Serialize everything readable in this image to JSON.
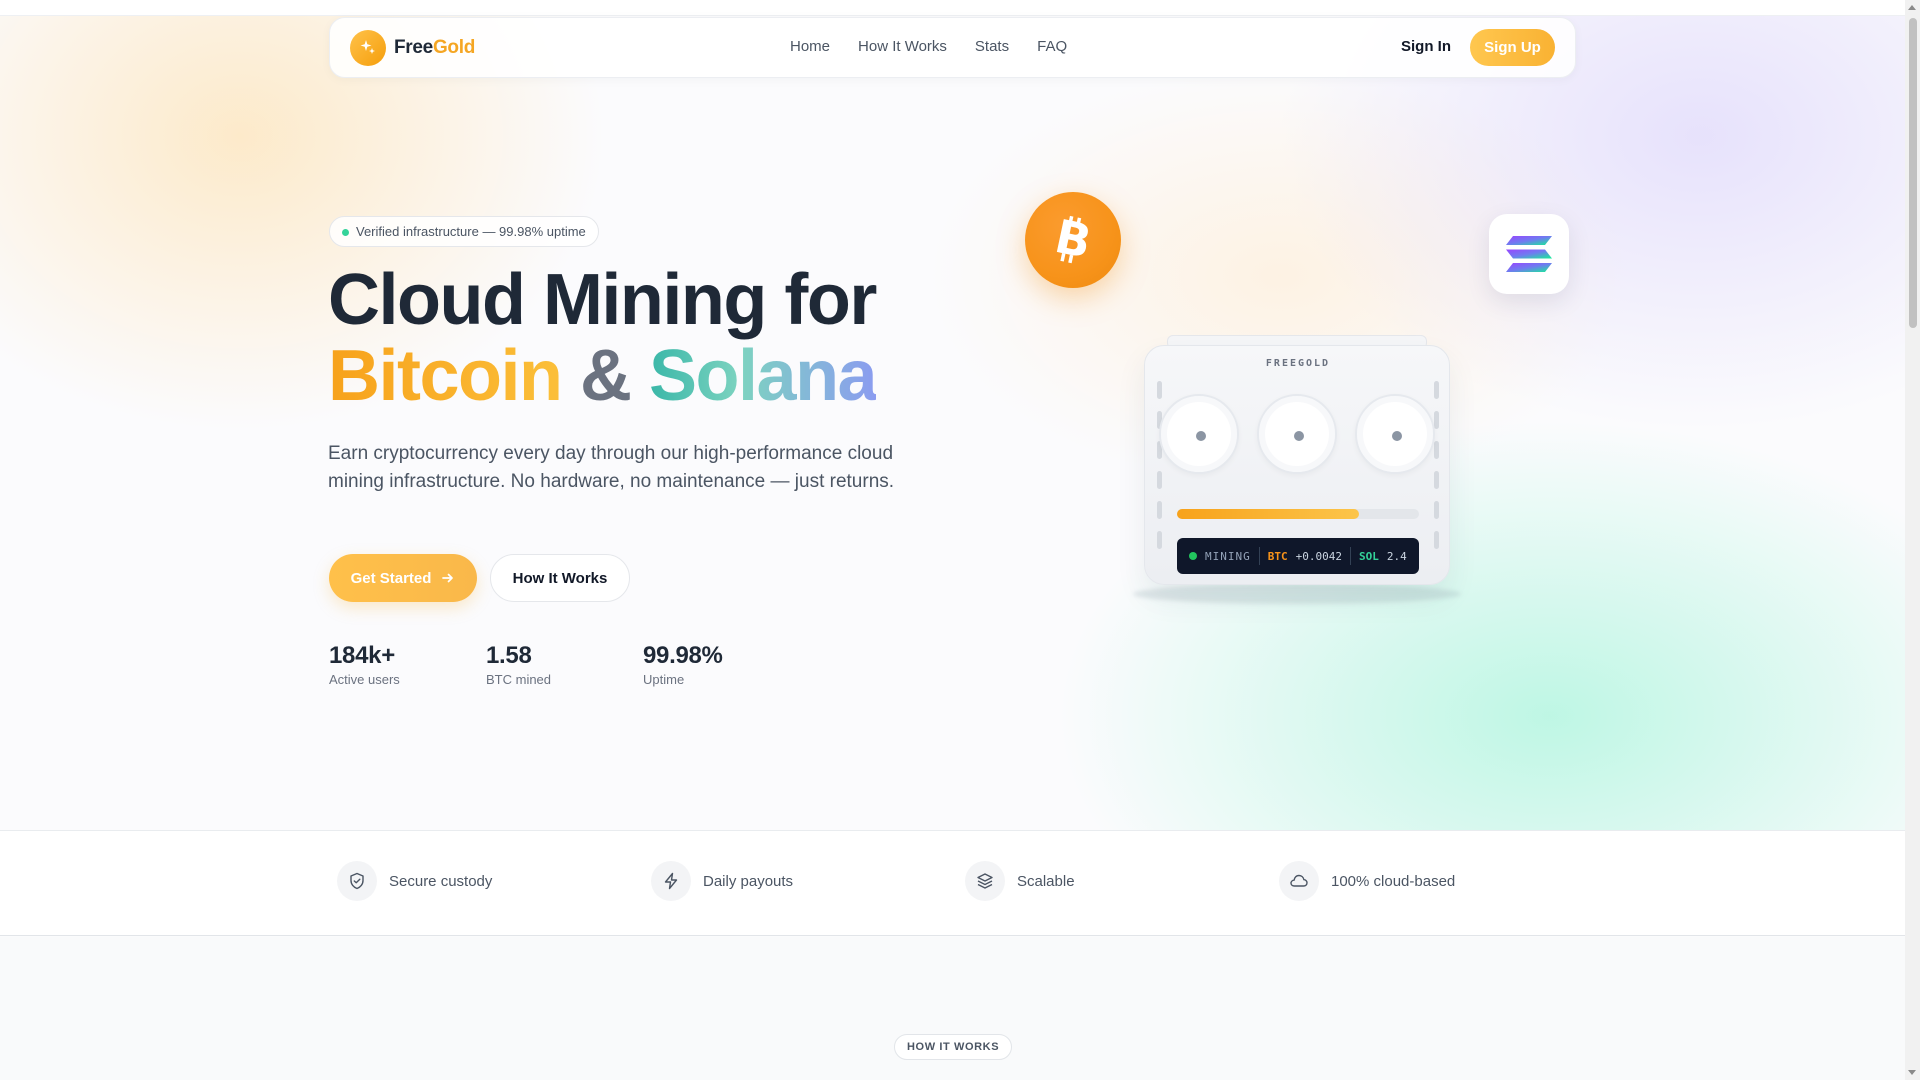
{
  "nav": {
    "brand_part1": "Free",
    "brand_part2": "Gold",
    "links": [
      "Home",
      "How It Works",
      "Stats",
      "FAQ"
    ],
    "signin_label": "Sign In",
    "signup_label": "Sign Up"
  },
  "hero": {
    "badge": "Verified infrastructure — 99.98% uptime",
    "title_line1": "Cloud Mining for",
    "title_btc": "Bitcoin",
    "title_amp": "&",
    "title_sol": "Solana",
    "subtitle": "Earn cryptocurrency every day through our high-performance cloud mining infrastructure. No hardware, no maintenance — just returns.",
    "cta_primary": "Get Started",
    "cta_secondary": "How It Works",
    "stats": [
      {
        "value": "184k+",
        "label": "Active users"
      },
      {
        "value": "1.58",
        "label": "BTC mined"
      },
      {
        "value": "99.98%",
        "label": "Uptime"
      }
    ]
  },
  "miner": {
    "label": "FREEGOLD",
    "progress": 0.75,
    "terminal_status": "MINING",
    "btc_label": "BTC",
    "btc_value": "+0.0042",
    "sol_label": "SOL",
    "sol_value": "2.4"
  },
  "features": [
    {
      "label": "Secure custody",
      "icon": "shield-icon"
    },
    {
      "label": "Daily payouts",
      "icon": "bolt-icon"
    },
    {
      "label": "Scalable",
      "icon": "layers-icon"
    },
    {
      "label": "100% cloud-based",
      "icon": "cloud-icon"
    }
  ],
  "section_tag": "HOW IT WORKS",
  "colors": {
    "accent": "#f9b233",
    "bitcoin": "#f7931a",
    "solana_teal": "#3ab7a8",
    "text_dark": "#1f2937"
  }
}
